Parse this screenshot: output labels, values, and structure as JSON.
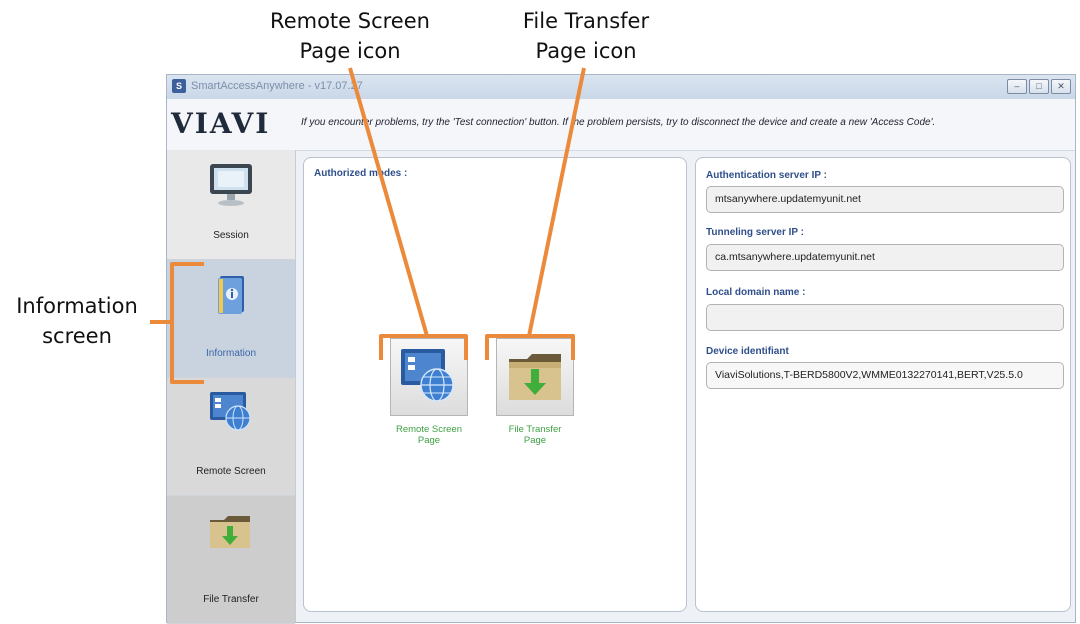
{
  "callouts": {
    "remote": [
      "Remote Screen",
      "Page icon"
    ],
    "file": [
      "File Transfer",
      "Page icon"
    ],
    "info": [
      "Information",
      "screen"
    ]
  },
  "window": {
    "title": "SmartAccessAnywhere - v17.07.27",
    "logo": "VIAVI",
    "message": "If you encounter problems, try the 'Test connection' button. If the problem persists, try to disconnect the device and create a new 'Access Code'."
  },
  "sidebar": {
    "items": [
      {
        "label": "Session",
        "icon": "monitor-icon"
      },
      {
        "label": "Information",
        "icon": "info-book-icon",
        "active": true
      },
      {
        "label": "Remote Screen",
        "icon": "remote-screen-icon"
      },
      {
        "label": "File Transfer",
        "icon": "folder-download-icon"
      }
    ]
  },
  "modes": {
    "heading": "Authorized modes :",
    "items": [
      {
        "label_line1": "Remote Screen",
        "label_line2": "Page",
        "icon": "remote-screen-icon"
      },
      {
        "label_line1": "File Transfer",
        "label_line2": "Page",
        "icon": "folder-download-icon"
      }
    ]
  },
  "info": {
    "auth_label": "Authentication server IP :",
    "auth_value": "mtsanywhere.updatemyunit.net",
    "tunnel_label": "Tunneling server IP :",
    "tunnel_value": "ca.mtsanywhere.updatemyunit.net",
    "domain_label": "Local domain name :",
    "domain_value": "",
    "device_label": "Device identifiant",
    "device_value": "ViaviSolutions,T-BERD5800V2,WMME0132270141,BERT,V25.5.0"
  },
  "colors": {
    "callout_orange": "#ec8a3c",
    "accent_blue": "#2f4f8a",
    "mode_green": "#3ea043"
  }
}
